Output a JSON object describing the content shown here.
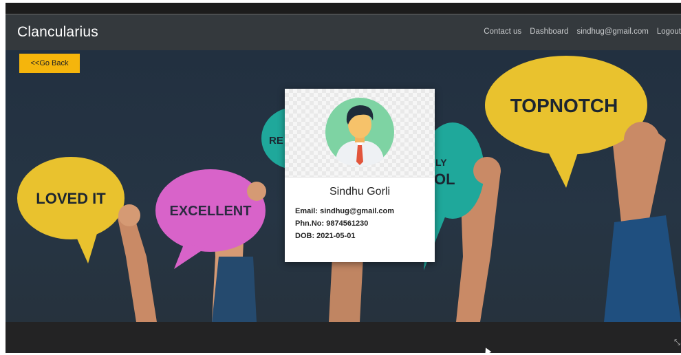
{
  "navbar": {
    "brand": "Clancularius",
    "links": [
      "Contact us",
      "Dashboard",
      "sindhug@gmail.com",
      "Logout"
    ]
  },
  "back_button": {
    "label": "<<Go Back"
  },
  "hero": {
    "bubbles": [
      "LOVED IT",
      "EXCELLENT",
      "RE",
      "LY",
      "OL",
      "TOPNOTCH"
    ]
  },
  "profile": {
    "name": "Sindhu Gorli",
    "email_label": "Email:",
    "email": "sindhug@gmail.com",
    "phone_label": "Phn.No:",
    "phone": "9874561230",
    "dob_label": "DOB:",
    "dob": "2021-05-01"
  },
  "colors": {
    "navbar": "#34393d",
    "accent_button": "#f5b50c",
    "bubble_yellow": "#e9c22e",
    "bubble_pink": "#d863c9",
    "bubble_teal": "#1fa89b",
    "avatar_bg": "#7ed3a3"
  }
}
